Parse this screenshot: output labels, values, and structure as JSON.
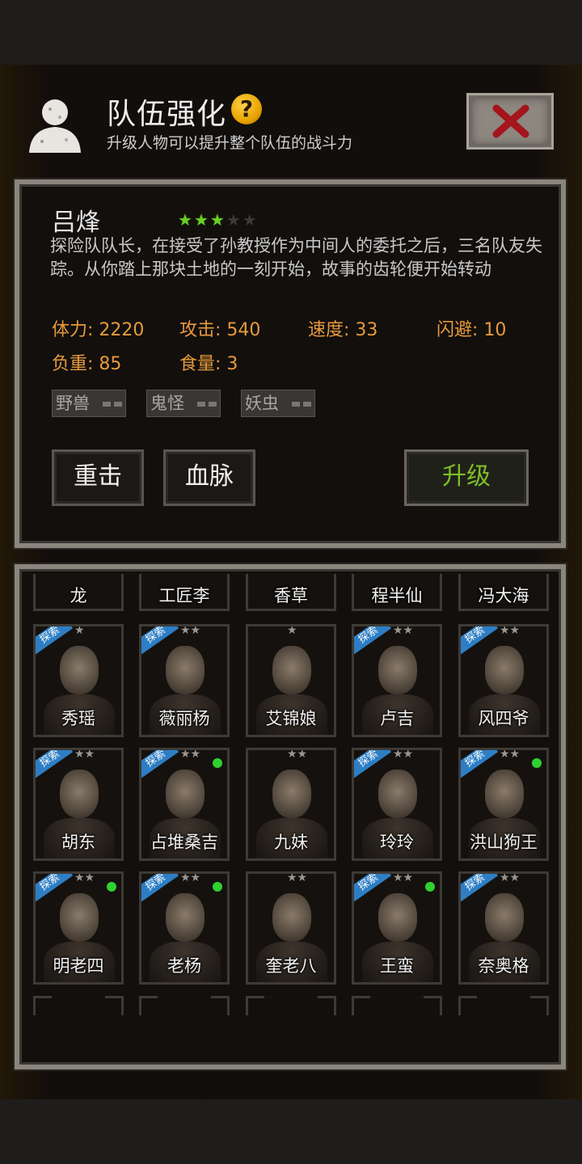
{
  "header": {
    "title": "队伍强化",
    "help_icon": "?",
    "subtitle": "升级人物可以提升整个队伍的战斗力",
    "close_icon": "close-icon"
  },
  "hero": {
    "name": "吕烽",
    "stars_filled": 3,
    "stars_total": 5,
    "description": "探险队队长，在接受了孙教授作为中间人的委托之后，三名队友失踪。从你踏上那块土地的一刻开始，故事的齿轮便开始转动",
    "stats": {
      "hp": "体力: 2220",
      "attack": "攻击: 540",
      "speed": "速度: 33",
      "dodge": "闪避: 10",
      "load": "负重: 85",
      "food": "食量: 3"
    },
    "traits": [
      "野兽",
      "鬼怪",
      "妖虫"
    ],
    "buttons": {
      "skill1": "重击",
      "skill2": "血脉",
      "upgrade": "升级"
    }
  },
  "roster": {
    "top_row": [
      "龙",
      "工匠李",
      "香草",
      "程半仙",
      "冯大海"
    ],
    "rows": [
      [
        {
          "name": "秀瑶",
          "badge": "探索",
          "stars": "★",
          "online": false
        },
        {
          "name": "薇丽杨",
          "badge": "探索",
          "stars": "★★",
          "online": false
        },
        {
          "name": "艾锦娘",
          "badge": "",
          "stars": "★",
          "online": false
        },
        {
          "name": "卢吉",
          "badge": "探索",
          "stars": "★★",
          "online": false
        },
        {
          "name": "风四爷",
          "badge": "探索",
          "stars": "★★",
          "online": false
        }
      ],
      [
        {
          "name": "胡东",
          "badge": "探索",
          "stars": "★★",
          "online": false
        },
        {
          "name": "占堆桑吉",
          "badge": "探索",
          "stars": "★★",
          "online": true
        },
        {
          "name": "九妹",
          "badge": "",
          "stars": "★★",
          "online": false
        },
        {
          "name": "玲玲",
          "badge": "探索",
          "stars": "★★",
          "online": false
        },
        {
          "name": "洪山狗王",
          "badge": "探索",
          "stars": "★★",
          "online": true
        }
      ],
      [
        {
          "name": "明老四",
          "badge": "探索",
          "stars": "★★",
          "online": true
        },
        {
          "name": "老杨",
          "badge": "探索",
          "stars": "★★",
          "online": true
        },
        {
          "name": "奎老八",
          "badge": "",
          "stars": "★★",
          "online": false
        },
        {
          "name": "王蛮",
          "badge": "探索",
          "stars": "★★",
          "online": true
        },
        {
          "name": "奈奥格",
          "badge": "探索",
          "stars": "★★",
          "online": false
        }
      ]
    ]
  },
  "colors": {
    "accent_orange": "#e89a3c",
    "star_green": "#6ccf2a",
    "upgrade_green": "#7fbf2a",
    "badge_blue": "#2d7ec4",
    "online_green": "#2fd12f"
  }
}
